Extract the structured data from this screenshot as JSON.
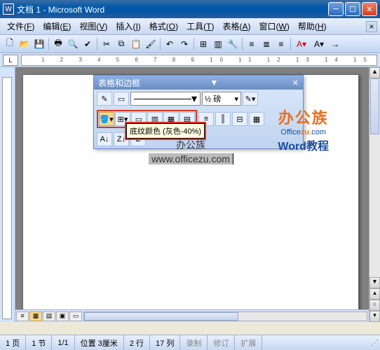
{
  "window": {
    "title": "文档 1 - Microsoft Word",
    "app_icon_letter": "W"
  },
  "menu": {
    "items": [
      {
        "label": "文件",
        "accel": "F"
      },
      {
        "label": "编辑",
        "accel": "E"
      },
      {
        "label": "视图",
        "accel": "V"
      },
      {
        "label": "插入",
        "accel": "I"
      },
      {
        "label": "格式",
        "accel": "O"
      },
      {
        "label": "工具",
        "accel": "T"
      },
      {
        "label": "表格",
        "accel": "A"
      },
      {
        "label": "窗口",
        "accel": "W"
      },
      {
        "label": "帮助",
        "accel": "H"
      }
    ]
  },
  "toolbar": {
    "icons": [
      "new",
      "open",
      "save",
      "print",
      "preview",
      "spell",
      "cut",
      "copy",
      "paste",
      "format-painter",
      "undo",
      "redo",
      "table",
      "columns",
      "toolbox",
      "zoom",
      "help"
    ],
    "right_icons": [
      "align-left",
      "align-center",
      "align-right",
      "font-color",
      "paragraph",
      "indent"
    ]
  },
  "ruler": {
    "box_label": "L"
  },
  "float_toolbar": {
    "title": "表格和边框",
    "line_weight": "½ 磅",
    "tooltip": "底纹颜色 (灰色-40%)",
    "row1_icons": [
      "draw-table",
      "eraser",
      "line-style",
      "weight",
      "border-color",
      "outside-border",
      "shading-color"
    ],
    "row2_icons": [
      "fill",
      "border-grid",
      "merge",
      "split",
      "align-top",
      "align-mid",
      "align-bottom",
      "distribute-rows",
      "distribute-cols",
      "table-autoformat",
      "sort-asc"
    ],
    "row3_icons": [
      "sort-az",
      "sort-za",
      "autosum"
    ]
  },
  "document": {
    "line1": "办公族",
    "line2": "www.officezu.com"
  },
  "watermark": {
    "brand_cn": "办公族",
    "brand_en_pre": "Office",
    "brand_en_accent": "zu",
    "brand_en_suffix": ".com",
    "subtitle": "Word教程"
  },
  "status": {
    "page": "1 页",
    "section": "1 节",
    "page_of": "1/1",
    "position": "位置 3厘米",
    "line": "2 行",
    "column": "17 列",
    "modes": [
      "录制",
      "修订",
      "扩展"
    ]
  }
}
